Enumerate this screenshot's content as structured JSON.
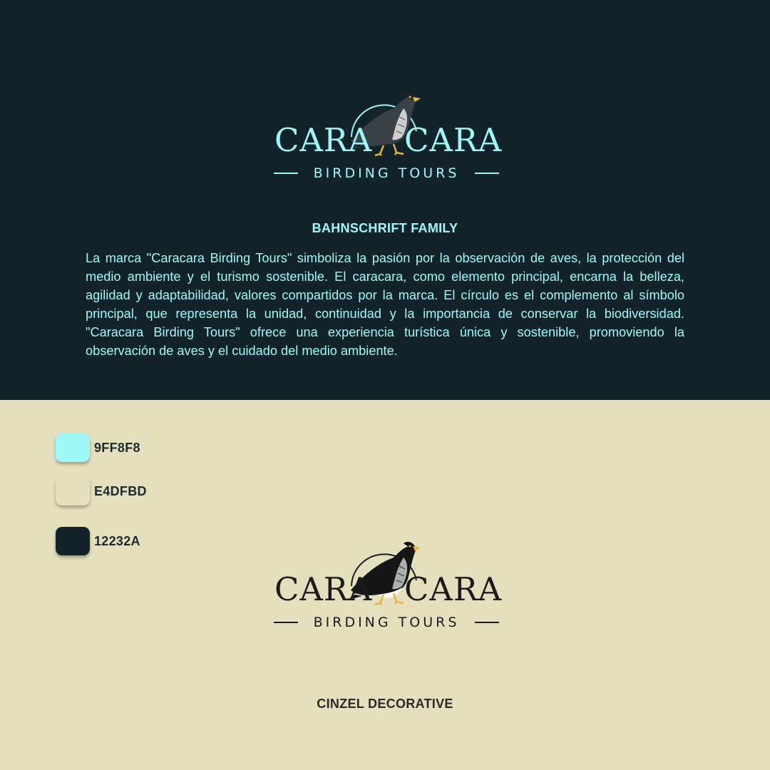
{
  "brand": {
    "wordmark_left": "CARA",
    "wordmark_right": "CARA",
    "tagline": "BIRDING TOURS"
  },
  "typography": {
    "primary_font_title": "BAHNSCHRIFT FAMILY",
    "secondary_font_title": "CINZEL DECORATIVE"
  },
  "description": "La marca \"Caracara Birding Tours\" simboliza la pasión por la observación de aves, la protección del medio ambiente y el turismo sostenible. El caracara, como elemento principal, encarna la belleza, agilidad y adaptabilidad, valores compartidos por la marca. El círculo es el complemento al símbolo principal, que representa la unidad, continuidad y la importancia de conservar la biodiversidad. \"Caracara Birding Tours\" ofrece una experiencia turística única y sostenible, promoviendo la observación de aves y el cuidado del medio ambiente.",
  "palette": [
    {
      "label": "9FF8F8",
      "color": "#9FF8F8"
    },
    {
      "label": "E4DFBD",
      "color": "#E4DFBD"
    },
    {
      "label": "12232A",
      "color": "#12232A"
    }
  ],
  "icons": {
    "logo_mark": "caracara-bird-icon"
  }
}
